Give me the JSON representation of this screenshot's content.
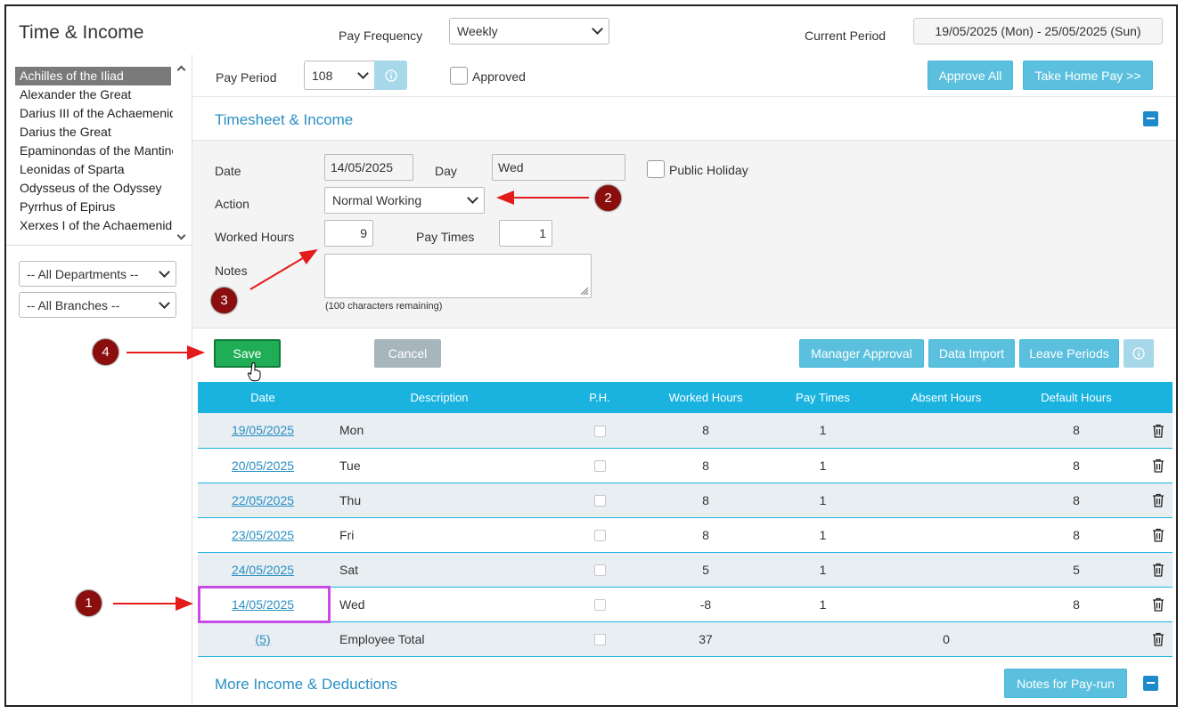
{
  "header": {
    "app_title": "Time & Income",
    "pay_frequency_label": "Pay Frequency",
    "pay_frequency_value": "Weekly",
    "current_period_label": "Current Period",
    "current_period_value": "19/05/2025 (Mon) - 25/05/2025 (Sun)"
  },
  "employees": {
    "items": [
      "Achilles of the Iliad",
      "Alexander the Great",
      "Darius III of the Achaemenid",
      "Darius the Great",
      "Epaminondas of the Mantinea",
      "Leonidas of Sparta",
      "Odysseus of the Odyssey",
      "Pyrrhus of Epirus",
      "Xerxes I of the Achaemenid"
    ],
    "selected_index": 0
  },
  "filters": {
    "departments": "-- All Departments --",
    "branches": "-- All Branches --"
  },
  "toolbar": {
    "pay_period_label": "Pay Period",
    "pay_period_value": "108",
    "approved_label": "Approved",
    "approve_all": "Approve All",
    "take_home_pay": "Take Home Pay >>"
  },
  "timesheet": {
    "section_title": "Timesheet & Income",
    "date_label": "Date",
    "date_value": "14/05/2025",
    "day_label": "Day",
    "day_value": "Wed",
    "public_holiday_label": "Public Holiday",
    "action_label": "Action",
    "action_value": "Normal Working",
    "worked_hours_label": "Worked Hours",
    "worked_hours_value": "9",
    "pay_times_label": "Pay Times",
    "pay_times_value": "1",
    "notes_label": "Notes",
    "notes_remaining": "(100 characters remaining)"
  },
  "actions": {
    "save": "Save",
    "cancel": "Cancel",
    "manager_approval": "Manager Approval",
    "data_import": "Data Import",
    "leave_periods": "Leave Periods"
  },
  "table": {
    "headers": [
      "Date",
      "Description",
      "P.H.",
      "Worked Hours",
      "Pay Times",
      "Absent Hours",
      "Default Hours"
    ],
    "rows": [
      {
        "date": "19/05/2025",
        "desc": "Mon",
        "wh": "8",
        "pt": "1",
        "ah": "",
        "dh": "8"
      },
      {
        "date": "20/05/2025",
        "desc": "Tue",
        "wh": "8",
        "pt": "1",
        "ah": "",
        "dh": "8"
      },
      {
        "date": "22/05/2025",
        "desc": "Thu",
        "wh": "8",
        "pt": "1",
        "ah": "",
        "dh": "8"
      },
      {
        "date": "23/05/2025",
        "desc": "Fri",
        "wh": "8",
        "pt": "1",
        "ah": "",
        "dh": "8"
      },
      {
        "date": "24/05/2025",
        "desc": "Sat",
        "wh": "5",
        "pt": "1",
        "ah": "",
        "dh": "5"
      },
      {
        "date": "14/05/2025",
        "desc": "Wed",
        "wh": "-8",
        "pt": "1",
        "ah": "",
        "dh": "8"
      },
      {
        "date": "(5)",
        "desc": "Employee Total",
        "wh": "37",
        "pt": "",
        "ah": "0",
        "dh": ""
      }
    ]
  },
  "more": {
    "section_title": "More Income & Deductions",
    "notes_for_payrun": "Notes for Pay-run"
  },
  "annotations": {
    "markers": [
      "1",
      "2",
      "3",
      "4"
    ],
    "arrow_color": "#e31b1b",
    "highlight_color": "#c94be6"
  }
}
